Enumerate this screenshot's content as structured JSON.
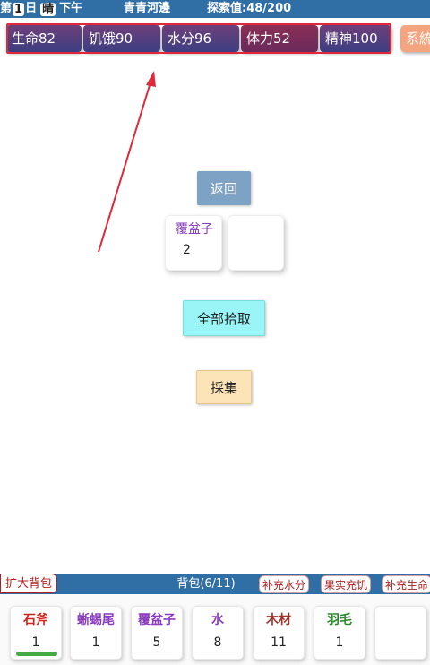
{
  "topbar": {
    "day_prefix": "第",
    "day_num": "1",
    "day_suffix": "日",
    "weather": "晴",
    "time": "下午",
    "location": "青青河邊",
    "explore": "探索值:48/200"
  },
  "stats": {
    "items": [
      {
        "label": "生命82",
        "color": "#4a3f80"
      },
      {
        "label": "饥饿90",
        "color": "#4a3f80"
      },
      {
        "label": "水分96",
        "color": "#4a3f80"
      },
      {
        "label": "体力52",
        "color": "#7a2d5a"
      },
      {
        "label": "精神100",
        "color": "#4a3f80"
      }
    ],
    "system_label": "系統"
  },
  "actions": {
    "back_label": "返回",
    "pickup_all_label": "全部拾取",
    "collect_label": "採集"
  },
  "loot": [
    {
      "name": "覆盆子",
      "count": "2"
    }
  ],
  "bag": {
    "expand_label": "扩大背包",
    "title": "背包(6/11)",
    "quick_actions": [
      "补充水分",
      "果实充饥",
      "补充生命"
    ],
    "items": [
      {
        "name": "石斧",
        "count": "1",
        "color": "#d0241a",
        "durability": 1.0
      },
      {
        "name": "蜥蜴尾",
        "count": "1",
        "color": "#8a3bbf"
      },
      {
        "name": "覆盆子",
        "count": "5",
        "color": "#8a3bbf"
      },
      {
        "name": "水",
        "count": "8",
        "color": "#8a3bbf"
      },
      {
        "name": "木材",
        "count": "11",
        "color": "#a0322a"
      },
      {
        "name": "羽毛",
        "count": "1",
        "color": "#2e8b2e"
      }
    ]
  },
  "colors": {
    "bar_blue": "#2f6fa6",
    "annotation_red": "#e0283a"
  }
}
